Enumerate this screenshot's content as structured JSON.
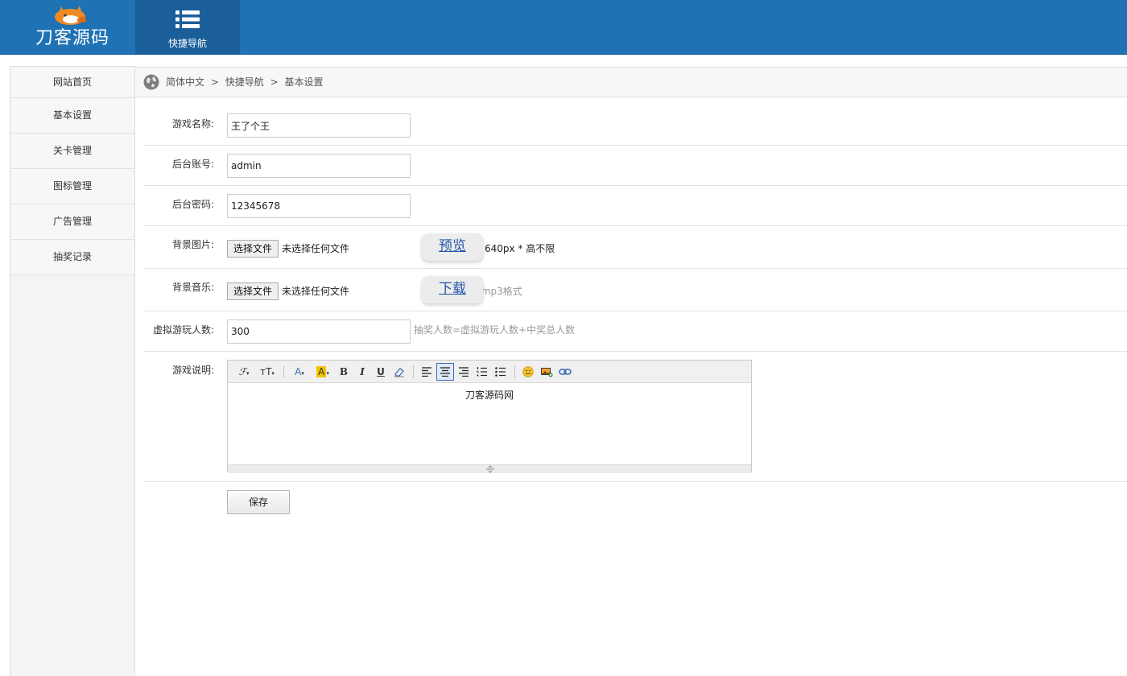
{
  "header": {
    "logo_text": "刀客源码",
    "nav_label": "快捷导航"
  },
  "sidebar": {
    "items": [
      {
        "label": "网站首页"
      },
      {
        "label": "基本设置"
      },
      {
        "label": "关卡管理"
      },
      {
        "label": "图标管理"
      },
      {
        "label": "广告管理"
      },
      {
        "label": "抽奖记录"
      }
    ]
  },
  "breadcrumb": {
    "level1": "简体中文",
    "level2": "快捷导航",
    "level3": "基本设置",
    "separator": ">"
  },
  "form": {
    "game_name": {
      "label": "游戏名称:",
      "value": "王了个王"
    },
    "admin_account": {
      "label": "后台账号:",
      "value": "admin"
    },
    "admin_password": {
      "label": "后台密码:",
      "value": "12345678"
    },
    "bg_image": {
      "label": "背景图片:",
      "button": "选择文件",
      "state": "未选择任何文件",
      "action": "预览",
      "hint": "640px * 高不限"
    },
    "bg_music": {
      "label": "背景音乐:",
      "button": "选择文件",
      "state": "未选择任何文件",
      "action": "下载",
      "hint": ".mp3格式"
    },
    "virtual_players": {
      "label": "虚拟游玩人数:",
      "value": "300",
      "hint": "抽奖人数=虚拟游玩人数+中奖总人数"
    },
    "description": {
      "label": "游戏说明:",
      "content": "刀客源码网"
    },
    "save_label": "保存"
  },
  "toolbar": {
    "font_family": "ℱ",
    "font_size": "ᴛT",
    "font_color": "A",
    "bg_color": "A",
    "bold": "B",
    "italic": "I",
    "underline": "U"
  },
  "colors": {
    "header_bg": "#1f72b4",
    "nav_tile_bg": "#1a5f99",
    "link": "#1f56a8"
  }
}
